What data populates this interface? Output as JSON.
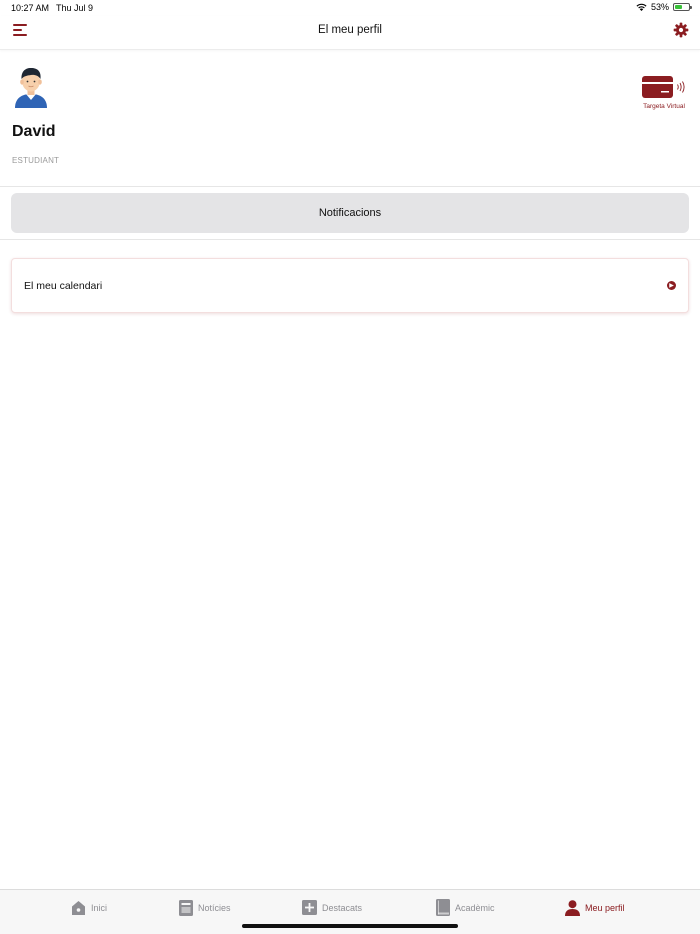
{
  "status_bar": {
    "time": "10:27 AM",
    "date": "Thu Jul 9",
    "battery": "53%",
    "battery_level": 0.53
  },
  "nav": {
    "title": "El meu perfil",
    "menu_icon": "hamburger-menu-icon",
    "settings_icon": "gear-icon"
  },
  "profile": {
    "name": "David",
    "role": "ESTUDIANT",
    "virtual_card_label": "Targeta Virtual",
    "avatar_icon": "user-avatar-icon",
    "card_icon": "credit-card-nfc-icon"
  },
  "notifications_label": "Notificacions",
  "calendar_label": "El meu calendari",
  "tabs": [
    {
      "label": "Inici",
      "icon": "home-icon"
    },
    {
      "label": "Notícies",
      "icon": "news-icon"
    },
    {
      "label": "Destacats",
      "icon": "plus-box-icon"
    },
    {
      "label": "Acadèmic",
      "icon": "book-icon"
    },
    {
      "label": "Meu perfil",
      "icon": "person-icon",
      "active": true
    }
  ],
  "colors": {
    "accent": "#8b1d21",
    "inactive": "#8e8e93",
    "button_bg": "#e4e4e6",
    "tabbar_bg": "#f7f7f7"
  }
}
